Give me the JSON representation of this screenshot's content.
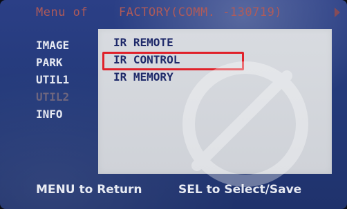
{
  "header": {
    "menu_label": "Menu of",
    "title": "FACTORY(COMM. -130719)"
  },
  "left_menu": {
    "items": [
      "IMAGE",
      "PARK",
      "UTIL1",
      "UTIL2",
      "INFO"
    ],
    "selected_index": 3
  },
  "panel": {
    "items": [
      "IR REMOTE",
      "IR CONTROL",
      "IR MEMORY"
    ],
    "highlighted_index": 1
  },
  "footer": {
    "left": "MENU to Return",
    "right": "SEL to Select/Save"
  },
  "colors": {
    "background": "#243a7a",
    "panel": "#d3d6db",
    "highlight": "#e0212a",
    "menu_text": "#e6e9f2",
    "header_text": "#b55b57"
  }
}
